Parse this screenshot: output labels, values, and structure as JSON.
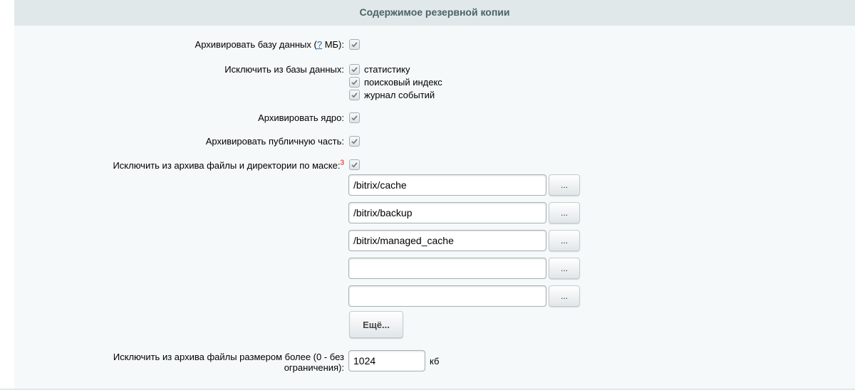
{
  "panel": {
    "title": "Содержимое резервной копии"
  },
  "colors": {
    "header_bg": "#e0e8ea",
    "header_text": "#4b6267",
    "panel_bg": "#f5f9f9",
    "link": "#2067b0",
    "required_mark": "#ff0000"
  },
  "rows": {
    "archive_db": {
      "label_prefix": "Архивировать базу данных (",
      "help_link": "?",
      "label_suffix": " МБ):",
      "checked": true
    },
    "exclude_db": {
      "label": "Исключить из базы данных:",
      "options": [
        {
          "label": "статистику",
          "checked": true
        },
        {
          "label": "поисковый индекс",
          "checked": true
        },
        {
          "label": "журнал событий",
          "checked": true
        }
      ]
    },
    "archive_core": {
      "label": "Архивировать ядро:",
      "checked": true
    },
    "archive_public": {
      "label": "Архивировать публичную часть:",
      "checked": true
    },
    "exclude_mask": {
      "label": "Исключить из архива файлы и директории по маске:",
      "footnote": "3",
      "checked": true,
      "masks": [
        "/bitrix/cache",
        "/bitrix/backup",
        "/bitrix/managed_cache",
        "",
        ""
      ],
      "browse_label": "...",
      "more_label": "Ещё..."
    },
    "exclude_size": {
      "label_line1": "Исключить из архива файлы размером более (0 - без",
      "label_line2": "ограничения):",
      "value": "1024",
      "unit": "кб"
    }
  }
}
